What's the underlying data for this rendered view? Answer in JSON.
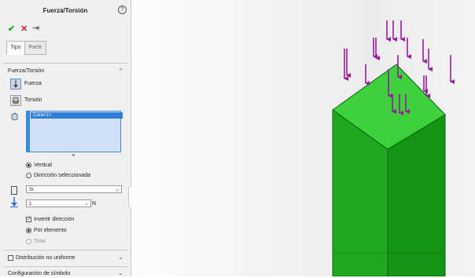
{
  "panel": {
    "title": "Fuerza/Torsión",
    "help_glyph": "?",
    "ok_glyph": "✔",
    "cancel_glyph": "✕",
    "pin_glyph": "⇥",
    "tabs": [
      {
        "label": "Tipo"
      },
      {
        "label": "Partir"
      }
    ],
    "section_title": "Fuerza/Torsión",
    "options": [
      {
        "label": "Fuerza"
      },
      {
        "label": "Torsión"
      }
    ],
    "selection_list": [
      "Cara<1>"
    ],
    "direction": {
      "vertical": "Vertical",
      "selected": "Dirección seleccionada"
    },
    "unit_system": "SI",
    "force_value": "1",
    "force_unit": "N",
    "invert_label": "Invertir dirección",
    "per_element_label": "Por elemento",
    "total_label": "Total",
    "non_uniform_label": "Distribución no uniforme",
    "symbol_config_label": "Configuración de símbolo"
  },
  "colors": {
    "accent_blue": "#3b89d9",
    "selection_blue": "#2e7fd5",
    "ok_green": "#2aa52a",
    "cancel_red": "#d02020",
    "arrow_magenta": "#9b1aa0",
    "prism_green": "#1fb21f",
    "top_face_green": "#3ed13e"
  }
}
